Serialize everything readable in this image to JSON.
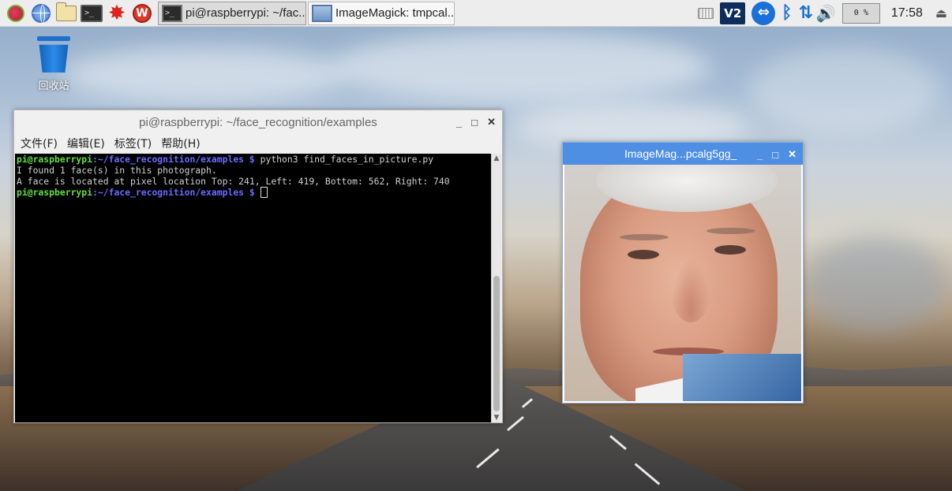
{
  "panel": {
    "launchers": [
      "raspberry-menu",
      "web-browser",
      "file-manager",
      "terminal",
      "mathematica",
      "wolfram"
    ],
    "tasks": [
      {
        "label": "pi@raspberrypi: ~/fac...",
        "active": true
      },
      {
        "label": "ImageMagick: tmpcal...",
        "active": false
      }
    ],
    "tray": {
      "ve_label": "V2",
      "tv_label": "⇔",
      "bt_symbol": "ᛒ",
      "net_symbol": "⇅",
      "vol_symbol": "🔊",
      "cpu_text": "0 %",
      "clock": "17:58",
      "eject_symbol": "⏏"
    },
    "term_glyph": ">_",
    "burst_glyph": "✸",
    "wolf_glyph": "W"
  },
  "desktop": {
    "trash_label": "回收站"
  },
  "terminal_window": {
    "title": "pi@raspberrypi: ~/face_recognition/examples",
    "buttons": {
      "minimize": "_",
      "maximize": "□",
      "close": "✕"
    },
    "menu": [
      "文件(F)",
      "编辑(E)",
      "标签(T)",
      "帮助(H)"
    ],
    "lines": [
      {
        "user": "pi@raspberrypi",
        "path": ":~/face_recognition/examples $",
        "cmd": " python3 find_faces_in_picture.py"
      },
      {
        "text": "I found 1 face(s) in this photograph."
      },
      {
        "text": "A face is located at pixel location Top: 241, Left: 419, Bottom: 562, Right: 740"
      },
      {
        "user": "pi@raspberrypi",
        "path": ":~/face_recognition/examples $",
        "cmd": " "
      }
    ],
    "scroll_up": "▲",
    "scroll_down": "▼"
  },
  "imagemagick_window": {
    "title": "ImageMag...pcalg5gg_",
    "buttons": {
      "minimize": "_",
      "maximize": "□",
      "close": "✕"
    }
  },
  "colors": {
    "prompt_user": "#5fe03b",
    "prompt_path": "#6b6bff",
    "im_titlebar": "#4f8fe3"
  }
}
